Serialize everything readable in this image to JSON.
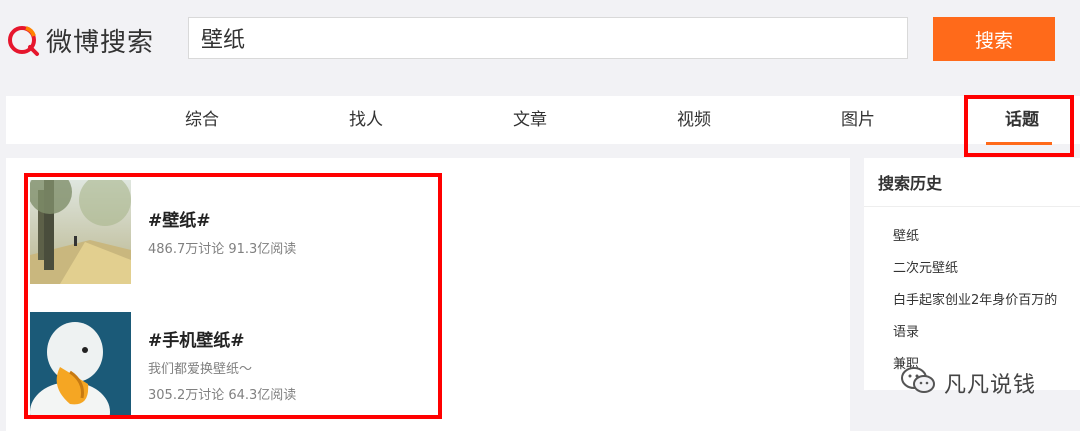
{
  "header": {
    "logo_text": "微博搜索",
    "search_value": "壁纸",
    "search_button": "搜索"
  },
  "tabs": [
    {
      "label": "综合"
    },
    {
      "label": "找人"
    },
    {
      "label": "文章"
    },
    {
      "label": "视频"
    },
    {
      "label": "图片"
    },
    {
      "label": "话题",
      "active": true
    }
  ],
  "topics": [
    {
      "title": "#壁纸#",
      "description": "",
      "stats": "486.7万讨论 91.3亿阅读"
    },
    {
      "title": "#手机壁纸#",
      "description": "我们都爱换壁纸～",
      "stats": "305.2万讨论 64.3亿阅读"
    }
  ],
  "sidebar": {
    "title": "搜索历史",
    "items": [
      "壁纸",
      "二次元壁纸",
      "白手起家创业2年身价百万的",
      "语录",
      "兼职"
    ]
  },
  "watermark": {
    "text": "凡凡说钱"
  },
  "colors": {
    "accent": "#ff6a1a",
    "highlight": "#ff0000"
  }
}
